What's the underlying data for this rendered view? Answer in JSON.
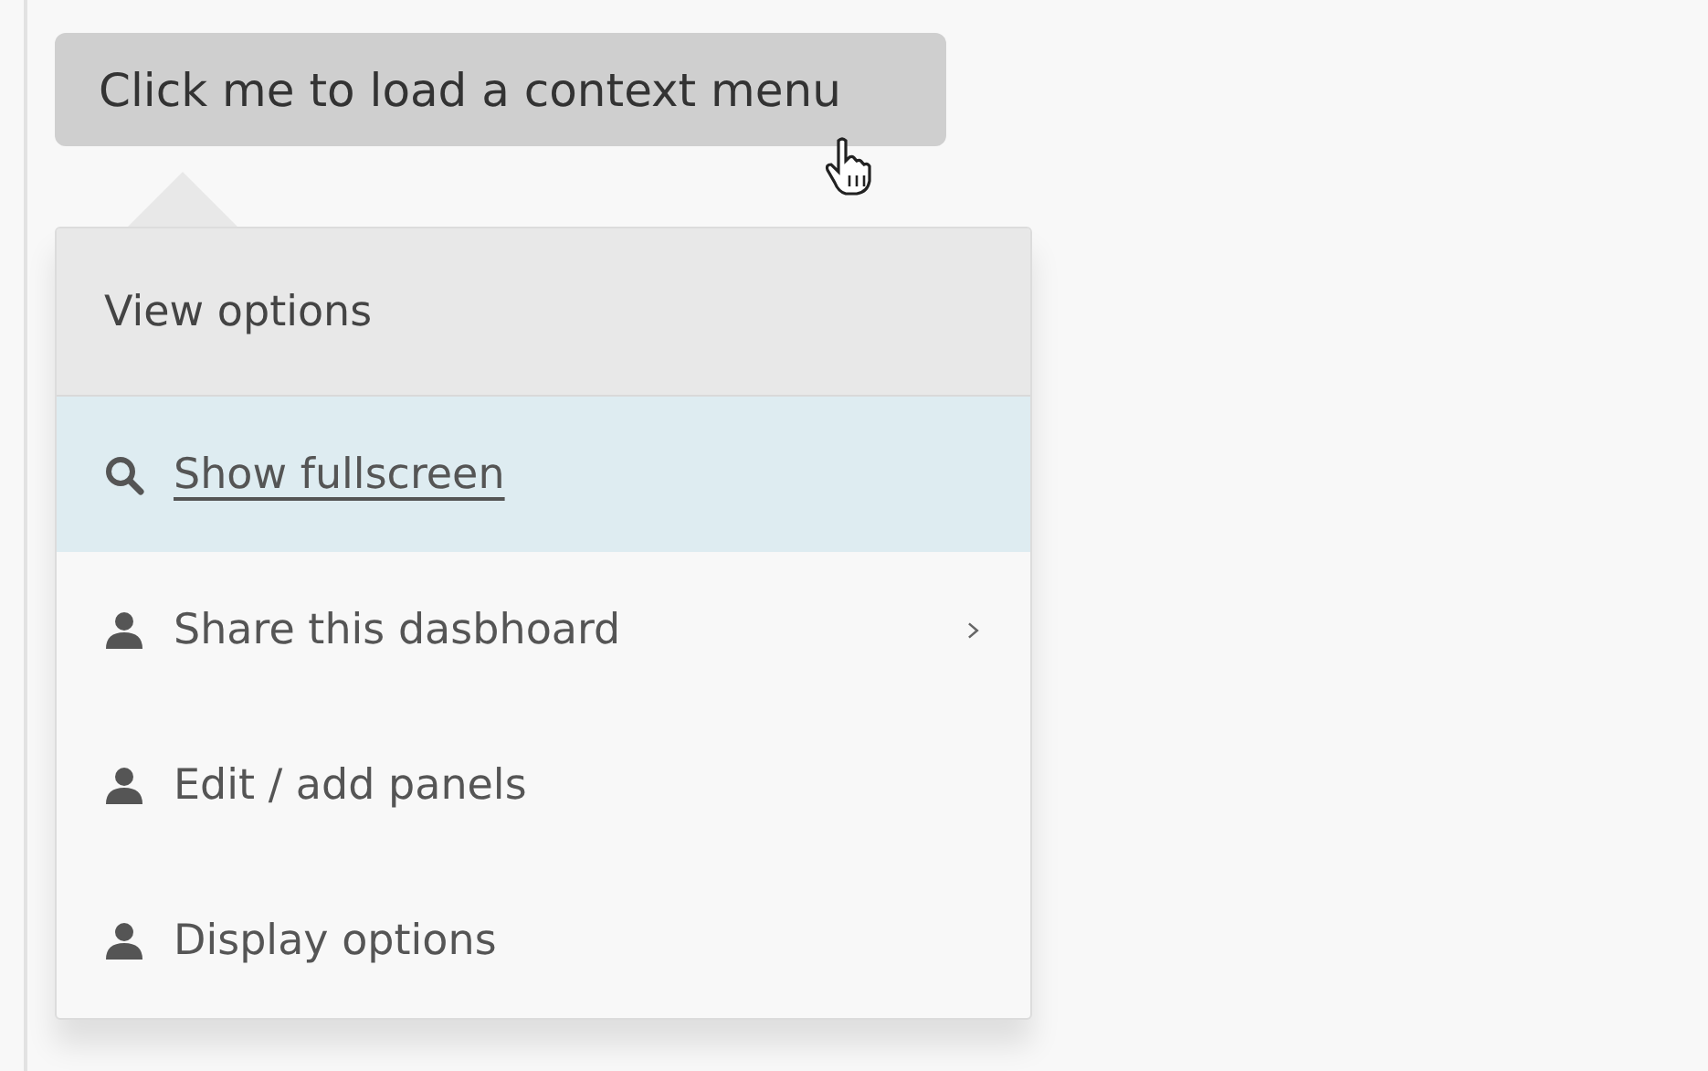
{
  "trigger_button": {
    "label": "Click me to load a context menu"
  },
  "context_menu": {
    "header": "View options",
    "items": [
      {
        "label": "Show fullscreen",
        "kind": "search",
        "selected": true,
        "submenu": false
      },
      {
        "label": "Share this dasbhoard",
        "kind": "user",
        "selected": false,
        "submenu": true
      },
      {
        "label": "Edit / add panels",
        "kind": "user",
        "selected": false,
        "submenu": false
      },
      {
        "label": "Display options",
        "kind": "user",
        "selected": false,
        "submenu": false
      }
    ]
  }
}
